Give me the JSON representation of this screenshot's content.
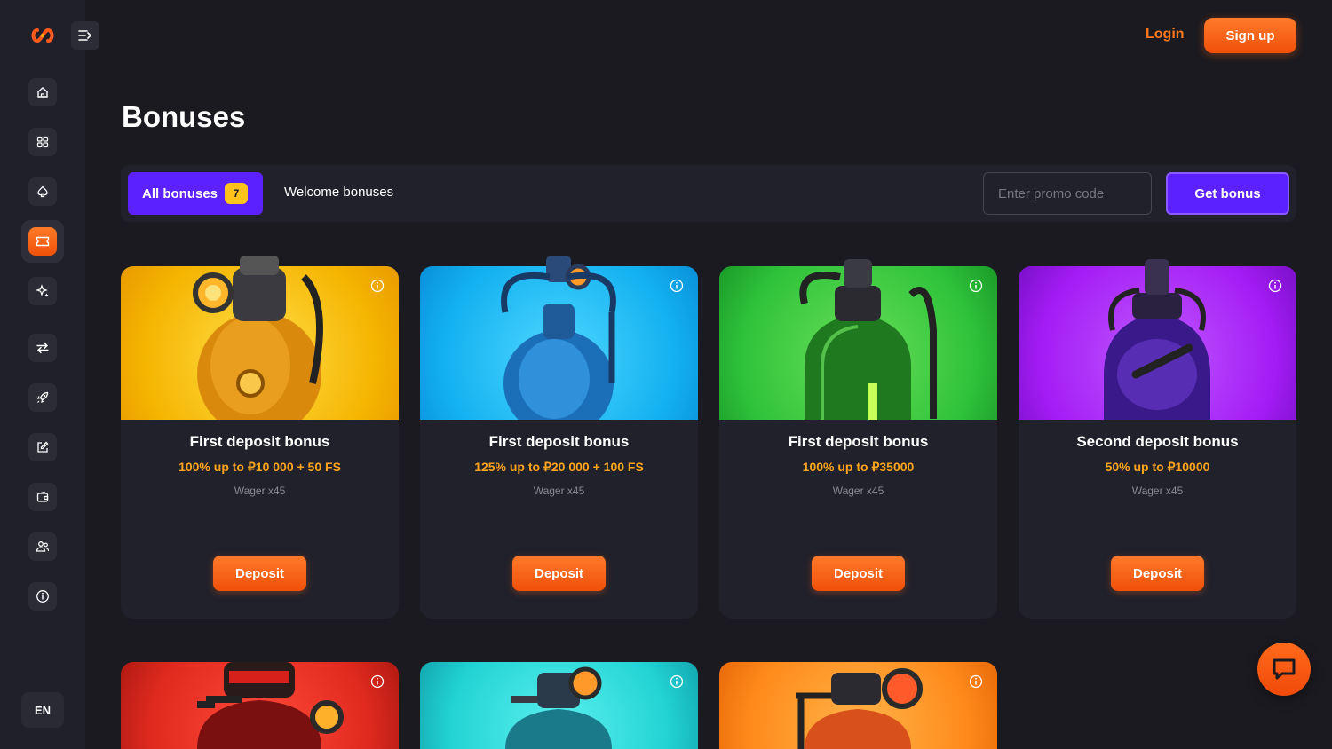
{
  "header": {
    "login_label": "Login",
    "signup_label": "Sign up"
  },
  "sidebar": {
    "items": [
      {
        "icon": "home-icon"
      },
      {
        "icon": "grid-icon"
      },
      {
        "icon": "spade-icon"
      },
      {
        "icon": "ticket-icon",
        "active": true
      },
      {
        "icon": "sparkle-icon"
      },
      {
        "icon": "transfer-icon"
      },
      {
        "icon": "rocket-icon"
      },
      {
        "icon": "edit-icon"
      },
      {
        "icon": "wallet-icon"
      },
      {
        "icon": "users-icon"
      },
      {
        "icon": "info-icon"
      }
    ],
    "language": "EN"
  },
  "page": {
    "title": "Bonuses"
  },
  "filters": {
    "tabs": [
      {
        "label": "All bonuses",
        "count": "7",
        "active": true
      },
      {
        "label": "Welcome bonuses",
        "active": false
      }
    ],
    "promo_placeholder": "Enter promo code",
    "get_bonus_label": "Get bonus"
  },
  "cards": [
    {
      "title": "First deposit bonus",
      "offer": "100% up to ₽10 000 + 50 FS",
      "wager": "Wager x45",
      "button": "Deposit",
      "color": "#ffc21a"
    },
    {
      "title": "First deposit bonus",
      "offer": "125% up to ₽20 000 + 100 FS",
      "wager": "Wager x45",
      "button": "Deposit",
      "color": "#12b8f5"
    },
    {
      "title": "First deposit bonus",
      "offer": "100% up to ₽35000",
      "wager": "Wager x45",
      "button": "Deposit",
      "color": "#2ec23a"
    },
    {
      "title": "Second deposit bonus",
      "offer": "50% up to ₽10000",
      "wager": "Wager x45",
      "button": "Deposit",
      "color": "#a41cf5"
    },
    {
      "color": "#e52a1f"
    },
    {
      "color": "#22d3d3"
    },
    {
      "color": "#ff8a1a"
    }
  ],
  "colors": {
    "accent_orange": "#ff7a1f",
    "accent_purple": "#5b21ff",
    "offer_text": "#ffa51f",
    "background": "#1a1a20"
  }
}
